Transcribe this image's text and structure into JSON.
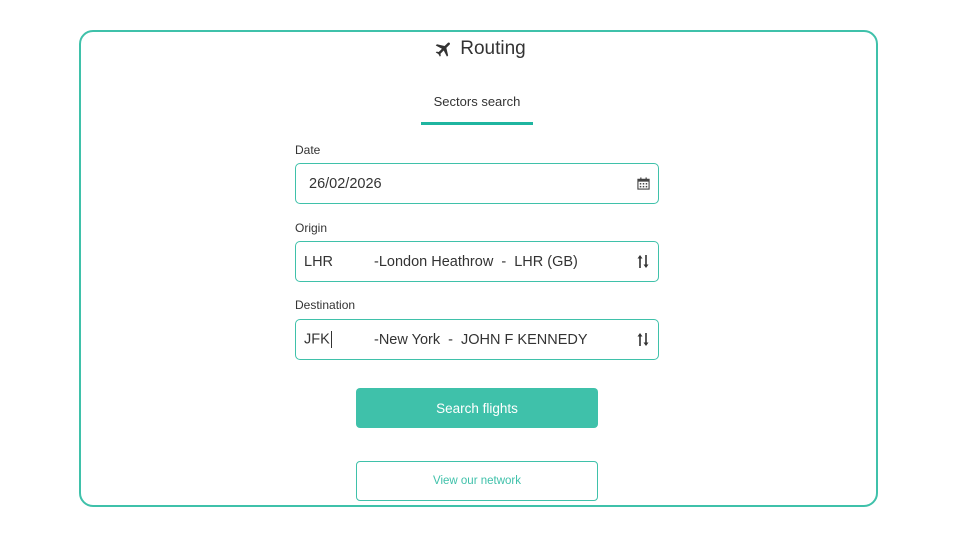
{
  "header": {
    "title": "Routing",
    "icon": "airplane-icon"
  },
  "tabs": [
    {
      "label": "Sectors search",
      "active": true
    }
  ],
  "form": {
    "date": {
      "label": "Date",
      "value": "26/02/2026",
      "icon": "calendar-icon"
    },
    "origin": {
      "label": "Origin",
      "code": "LHR",
      "name": "-London Heathrow  -  LHR (GB)",
      "icon": "swap-arrows-icon"
    },
    "destination": {
      "label": "Destination",
      "code": "JFK",
      "name": "-New York  -  JOHN F KENNEDY",
      "icon": "swap-arrows-icon"
    }
  },
  "actions": {
    "search_label": "Search flights",
    "network_label": "View our network"
  },
  "colors": {
    "accent": "#3fc1aa",
    "tab_underline": "#1fb5a0",
    "text": "#333333"
  }
}
